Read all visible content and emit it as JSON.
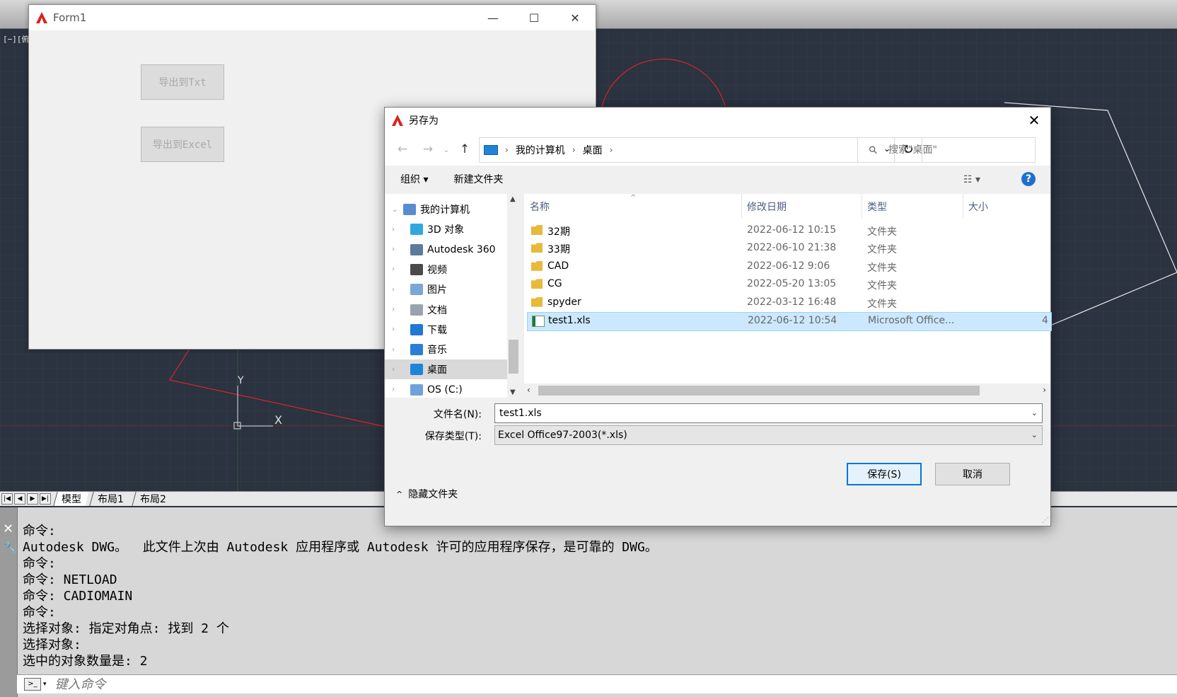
{
  "cad": {
    "viewport_label": "[−][俯视",
    "layout_tabs": [
      "模型",
      "布局1",
      "布局2"
    ],
    "command_history": [
      "命令:",
      "Autodesk DWG。  此文件上次由 Autodesk 应用程序或 Autodesk 许可的应用程序保存，是可靠的 DWG。",
      "命令:",
      "命令: NETLOAD",
      "命令: CADIOMAIN",
      "命令:",
      "选择对象: 指定对角点: 找到 2 个",
      "选择对象:",
      "选中的对象数量是: 2"
    ],
    "command_placeholder": "键入命令",
    "axis_x": "X",
    "axis_y": "Y"
  },
  "form1": {
    "title": "Form1",
    "btn_export_txt": "导出到Txt",
    "btn_export_excel": "导出到Excel"
  },
  "saveas": {
    "title": "另存为",
    "breadcrumb": [
      "我的计算机",
      "桌面"
    ],
    "search_placeholder": "搜索\"桌面\"",
    "organize": "组织 ▾",
    "new_folder": "新建文件夹",
    "tree": [
      {
        "label": "我的计算机",
        "icon": "computer-icon",
        "color": "#5a8bd0"
      },
      {
        "label": "3D 对象",
        "icon": "3d-objects-icon",
        "color": "#2fa8e0"
      },
      {
        "label": "Autodesk 360",
        "icon": "autodesk-360-icon",
        "color": "#5c7c9a"
      },
      {
        "label": "视频",
        "icon": "video-icon",
        "color": "#4a4a4a"
      },
      {
        "label": "图片",
        "icon": "pictures-icon",
        "color": "#7aa7d6"
      },
      {
        "label": "文档",
        "icon": "documents-icon",
        "color": "#9aa3ad"
      },
      {
        "label": "下载",
        "icon": "downloads-icon",
        "color": "#1e78d4"
      },
      {
        "label": "音乐",
        "icon": "music-icon",
        "color": "#2a7ed8"
      },
      {
        "label": "桌面",
        "icon": "desktop-icon",
        "color": "#1e84d8"
      },
      {
        "label": "OS (C:)",
        "icon": "drive-icon",
        "color": "#6fa2d8"
      }
    ],
    "columns": {
      "name": "名称",
      "date": "修改日期",
      "type": "类型",
      "size": "大小"
    },
    "files": [
      {
        "name": "32期",
        "date": "2022-06-12 10:15",
        "type": "文件夹",
        "size": "",
        "icon": "folder-icon"
      },
      {
        "name": "33期",
        "date": "2022-06-10 21:38",
        "type": "文件夹",
        "size": "",
        "icon": "folder-icon"
      },
      {
        "name": "CAD",
        "date": "2022-06-12 9:06",
        "type": "文件夹",
        "size": "",
        "icon": "folder-icon"
      },
      {
        "name": "CG",
        "date": "2022-05-20 13:05",
        "type": "文件夹",
        "size": "",
        "icon": "folder-icon"
      },
      {
        "name": "spyder",
        "date": "2022-03-12 16:48",
        "type": "文件夹",
        "size": "",
        "icon": "folder-icon"
      },
      {
        "name": "test1.xls",
        "date": "2022-06-12 10:54",
        "type": "Microsoft Office...",
        "size": "4",
        "icon": "excel-file-icon"
      }
    ],
    "filename_label": "文件名(N):",
    "filename_value": "test1.xls",
    "filetype_label": "保存类型(T):",
    "filetype_value": "Excel Office97-2003(*.xls)",
    "hide_folders": "隐藏文件夹",
    "save": "保存(S)",
    "cancel": "取消"
  },
  "colors": {
    "cad_bg": "#2b3240",
    "accent": "#0078d7",
    "selected_row": "#cce8ff",
    "folder": "#e8b93a"
  }
}
